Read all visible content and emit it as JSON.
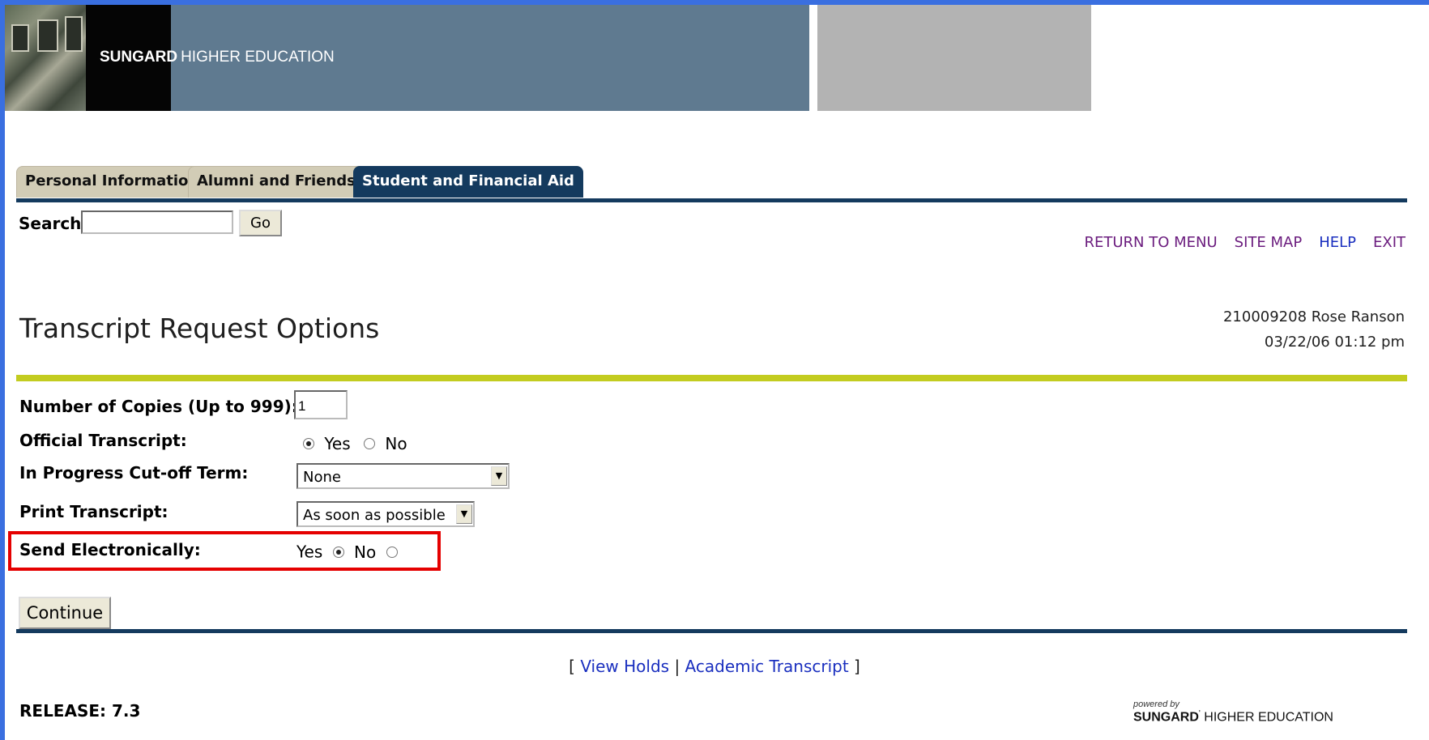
{
  "banner": {
    "brand_bold": "SUNGARD",
    "brand_text": "HIGHER EDUCATION"
  },
  "tabs": [
    {
      "label": "Personal Information",
      "active": false
    },
    {
      "label": "Alumni and Friends",
      "active": false
    },
    {
      "label": "Student and Financial Aid",
      "active": true
    }
  ],
  "search": {
    "label": "Search",
    "value": "",
    "button": "Go"
  },
  "nav": {
    "return_menu": "RETURN TO MENU",
    "site_map": "SITE MAP",
    "help": "HELP",
    "exit": "EXIT"
  },
  "page": {
    "title": "Transcript Request Options",
    "user": "210009208 Rose Ranson",
    "datetime": "03/22/06 01:12 pm"
  },
  "form": {
    "copies_label": "Number of Copies (Up to 999):",
    "copies_value": "1",
    "official_label": "Official Transcript:",
    "official_yes": "Yes",
    "official_no": "No",
    "official_selected": "Yes",
    "cutoff_label": "In Progress Cut-off Term:",
    "cutoff_value": "None",
    "print_label": "Print Transcript:",
    "print_value": "As soon as possible",
    "electronic_label": "Send Electronically:",
    "electronic_yes": "Yes",
    "electronic_no": "No",
    "electronic_selected": "Yes",
    "continue": "Continue"
  },
  "footer": {
    "bracket_open": "[",
    "view_holds": "View Holds",
    "separator": "|",
    "academic_transcript": "Academic Transcript",
    "bracket_close": "]",
    "release": "RELEASE: 7.3",
    "powered_by": "powered by",
    "powered_brand_bold": "SUNGARD",
    "powered_reg": "'",
    "powered_brand_text": "HIGHER EDUCATION"
  },
  "colors": {
    "frame": "#3a6fe0",
    "tab_active": "#143a5e",
    "tab_inactive": "#d2ccb6",
    "olive_rule": "#c3cc20",
    "highlight": "#e50000",
    "link_visited": "#6b1c7e",
    "link": "#1a2fbf"
  }
}
